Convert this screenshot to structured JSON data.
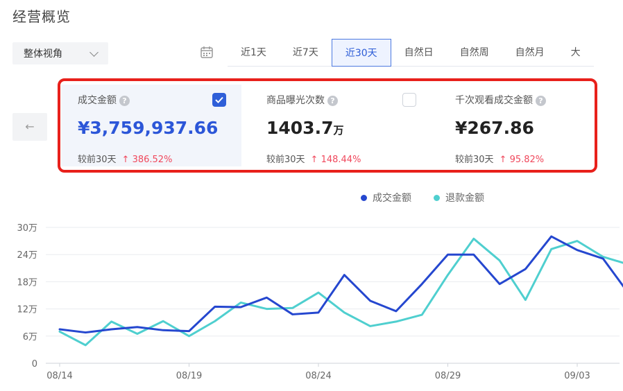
{
  "page_title": "经营概览",
  "view_select": {
    "value": "整体视角"
  },
  "date_tabs": [
    "近1天",
    "近7天",
    "近30天",
    "自然日",
    "自然周",
    "自然月",
    "大"
  ],
  "active_tab_index": 2,
  "back_arrow": "←",
  "metrics": [
    {
      "label": "成交金额",
      "value": "¥3,759,937.66",
      "unit": "",
      "compare_label": "较前30天",
      "change": "386.52%",
      "checked": true
    },
    {
      "label": "商品曝光次数",
      "value": "1403.7",
      "unit": "万",
      "compare_label": "较前30天",
      "change": "148.44%",
      "checked": false
    },
    {
      "label": "千次观看成交金额",
      "value": "¥267.86",
      "unit": "",
      "compare_label": "较前30天",
      "change": "95.82%",
      "checked": false
    }
  ],
  "colors": {
    "accent": "#2c56d8",
    "series1": "#2547cf",
    "series2": "#4fcfcf",
    "highlight": "#e8201b",
    "up": "#f0485c"
  },
  "chart_data": {
    "type": "line",
    "x": [
      "08/14",
      "08/15",
      "08/16",
      "08/17",
      "08/18",
      "08/19",
      "08/20",
      "08/21",
      "08/22",
      "08/23",
      "08/24",
      "08/25",
      "08/26",
      "08/27",
      "08/28",
      "08/29",
      "08/30",
      "08/31",
      "09/01",
      "09/02",
      "09/03",
      "09/04",
      "09/05"
    ],
    "x_tick_labels": [
      "08/14",
      "08/19",
      "08/24",
      "08/29",
      "09/03"
    ],
    "y_tick_labels": [
      "0",
      "6万",
      "12万",
      "18万",
      "24万",
      "30万"
    ],
    "ylim": [
      0,
      300000
    ],
    "legend_position": "top",
    "grid": true,
    "series": [
      {
        "name": "成交金额",
        "values": [
          75000,
          68000,
          75000,
          80000,
          73000,
          71000,
          125000,
          124000,
          145000,
          108000,
          112000,
          195000,
          138000,
          115000,
          175000,
          240000,
          240000,
          175000,
          208000,
          280000,
          250000,
          231000,
          153000
        ]
      },
      {
        "name": "退款金额",
        "values": [
          70000,
          40000,
          92000,
          65000,
          93000,
          60000,
          93000,
          134000,
          120000,
          122000,
          156000,
          112000,
          82000,
          92000,
          107000,
          195000,
          275000,
          227000,
          140000,
          252000,
          270000,
          235000,
          218000
        ]
      }
    ]
  }
}
